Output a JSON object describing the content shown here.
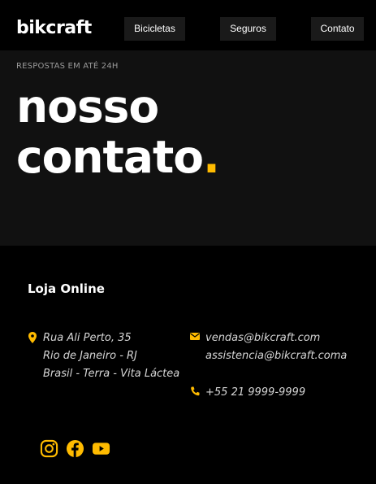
{
  "header": {
    "logo": "bikcraft",
    "nav": [
      "Bicicletas",
      "Seguros",
      "Contato"
    ]
  },
  "hero": {
    "eyebrow": "RESPOSTAS EM ATÉ 24H",
    "title_line1": "nosso",
    "title_line2": "contato",
    "title_dot": "."
  },
  "info": {
    "store_title": "Loja Online",
    "address": [
      "Rua Ali Perto, 35",
      "Rio de Janeiro - RJ",
      "Brasil - Terra - Vita Láctea"
    ],
    "emails": [
      "vendas@bikcraft.com",
      "assistencia@bikcraft.coma"
    ],
    "phone": "+55 21 9999-9999"
  },
  "icons": {
    "location": "location-pin-icon",
    "email": "envelope-icon",
    "phone": "phone-icon",
    "socials": [
      "instagram-icon",
      "facebook-icon",
      "youtube-icon"
    ]
  },
  "colors": {
    "accent": "#ffbb00",
    "hero_bg": "#111111",
    "page_bg": "#000000"
  }
}
